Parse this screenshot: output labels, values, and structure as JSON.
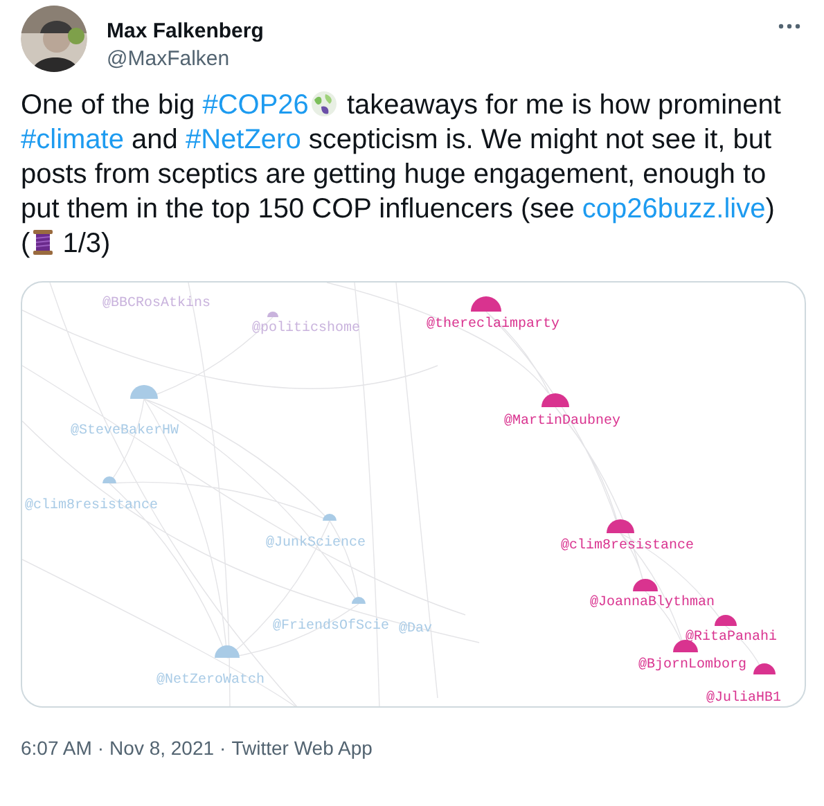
{
  "author": {
    "name": "Max Falkenberg",
    "handle": "@MaxFalken"
  },
  "tweet": [
    {
      "kind": "text",
      "text": "One of the big "
    },
    {
      "kind": "hashtag",
      "text": "#COP26"
    },
    {
      "kind": "icon"
    },
    {
      "kind": "text",
      "text": " takeaways for me is how prominent "
    },
    {
      "kind": "hashtag",
      "text": "#climate"
    },
    {
      "kind": "text",
      "text": " and "
    },
    {
      "kind": "hashtag",
      "text": "#NetZero"
    },
    {
      "kind": "text",
      "text": " scepticism is. We might not see it, but posts from sceptics are getting huge engagement, enough to put them in the top 150 COP influencers (see "
    },
    {
      "kind": "link",
      "text": "cop26buzz.live"
    },
    {
      "kind": "text",
      "text": ") ("
    },
    {
      "kind": "icon"
    },
    {
      "kind": "text",
      "text": " 1/3)"
    }
  ],
  "graph": {
    "nodes": [
      {
        "label": "@BBCRosAtkins",
        "color": "#c9b3dd"
      },
      {
        "label": "@politicshome",
        "color": "#c9b3dd"
      },
      {
        "label": "@SteveBakerHW",
        "color": "#a9cbe6"
      },
      {
        "label": "@clim8resistance",
        "color": "#a9cbe6"
      },
      {
        "label": "@JunkScience",
        "color": "#a9cbe6"
      },
      {
        "label": "@FriendsOfScie",
        "color": "#a9cbe6"
      },
      {
        "label": "@Dav",
        "color": "#a9cbe6"
      },
      {
        "label": "@NetZeroWatch",
        "color": "#a9cbe6"
      },
      {
        "label": "@thereclaimparty",
        "color": "#d9338f"
      },
      {
        "label": "@MartinDaubney",
        "color": "#d9338f"
      },
      {
        "label": "@clim8resistance",
        "color": "#d9338f"
      },
      {
        "label": "@JoannaBlythman",
        "color": "#d9338f"
      },
      {
        "label": "@RitaPanahi",
        "color": "#d9338f"
      },
      {
        "label": "@BjornLomborg",
        "color": "#d9338f"
      },
      {
        "label": "@JuliaHB1",
        "color": "#d9338f"
      }
    ]
  },
  "footer": {
    "time": "6:07 AM",
    "separator_1": "·",
    "date": "Nov 8, 2021",
    "separator_2": "·",
    "source": "Twitter Web App"
  }
}
